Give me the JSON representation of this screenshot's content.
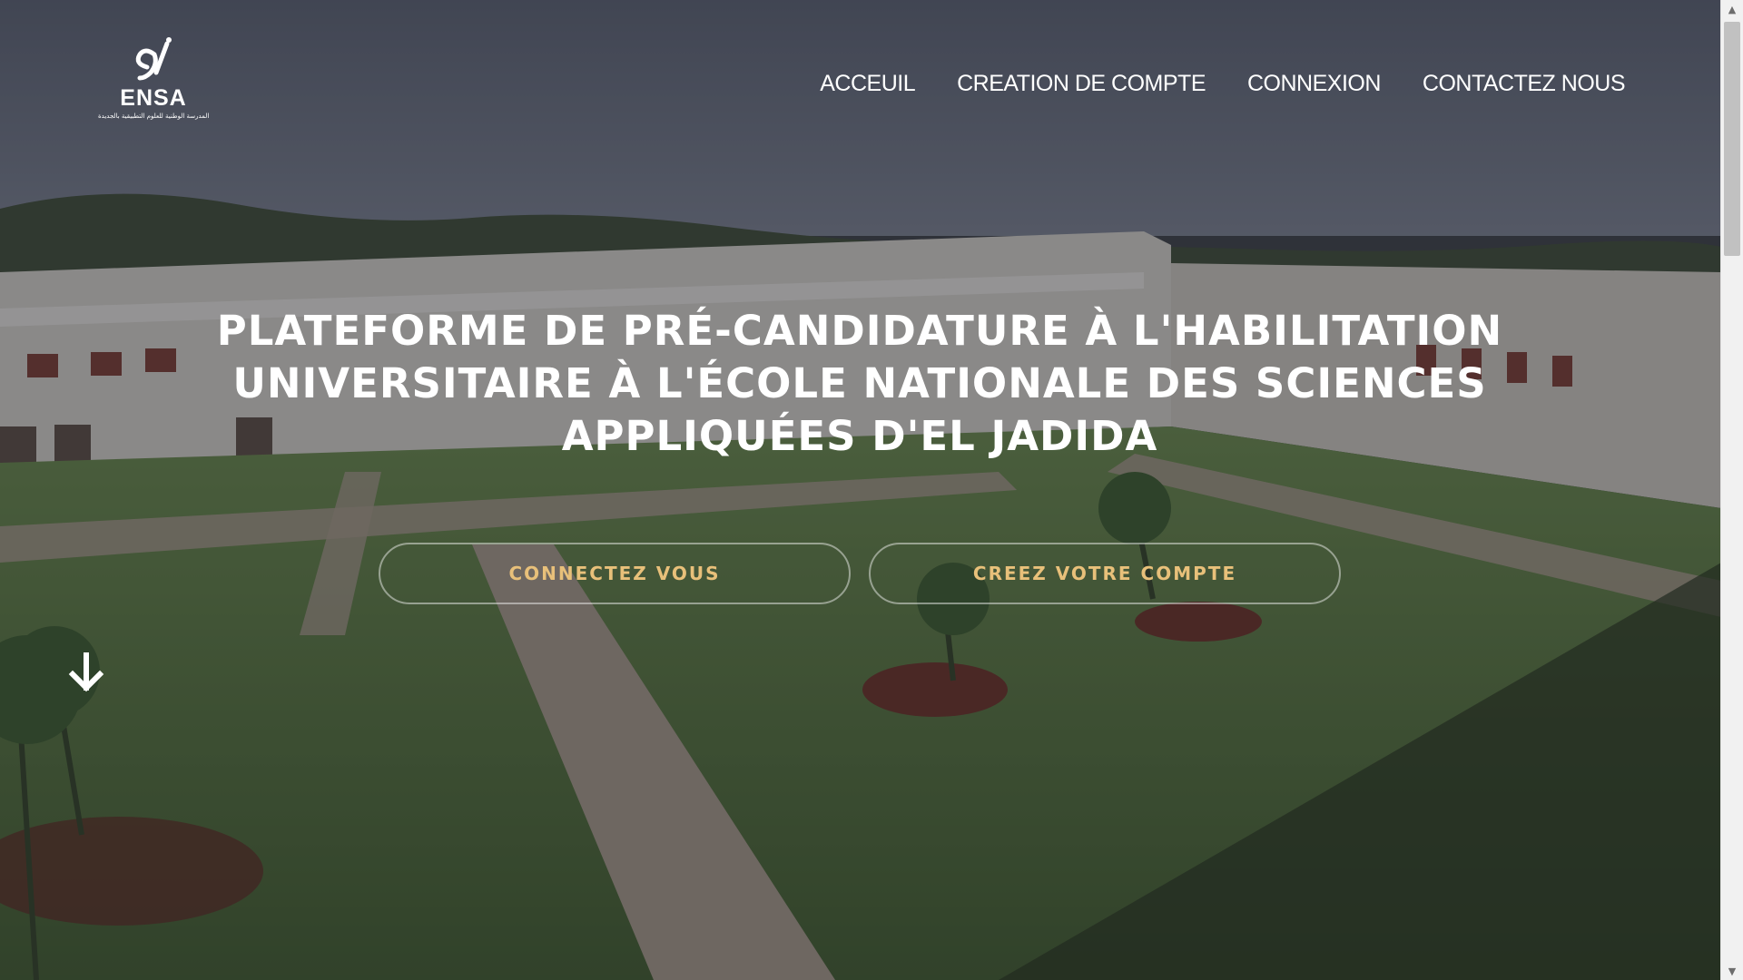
{
  "logo": {
    "name": "ENSA",
    "subtitle": "المدرسة الوطنية للعلوم التطبيقية بالجديدة"
  },
  "nav": {
    "items": [
      {
        "label": "ACCEUIL"
      },
      {
        "label": "CREATION DE COMPTE"
      },
      {
        "label": "CONNEXION"
      },
      {
        "label": "CONTACTEZ NOUS"
      }
    ]
  },
  "hero": {
    "title": "PLATEFORME DE PRÉ-CANDIDATURE À L'HABILITATION UNIVERSITAIRE À L'ÉCOLE NATIONALE DES SCIENCES APPLIQUÉES D'EL JADIDA",
    "buttons": {
      "login_label": "CONNECTEZ VOUS",
      "create_label": "CREEZ VOTRE COMPTE"
    },
    "scroll_icon": "arrow-down-icon"
  },
  "colors": {
    "accent": "#e8c07a",
    "text": "#ffffff",
    "overlay": "#1e222a"
  },
  "scrollbar": {
    "up_icon": "▲",
    "down_icon": "▼"
  }
}
